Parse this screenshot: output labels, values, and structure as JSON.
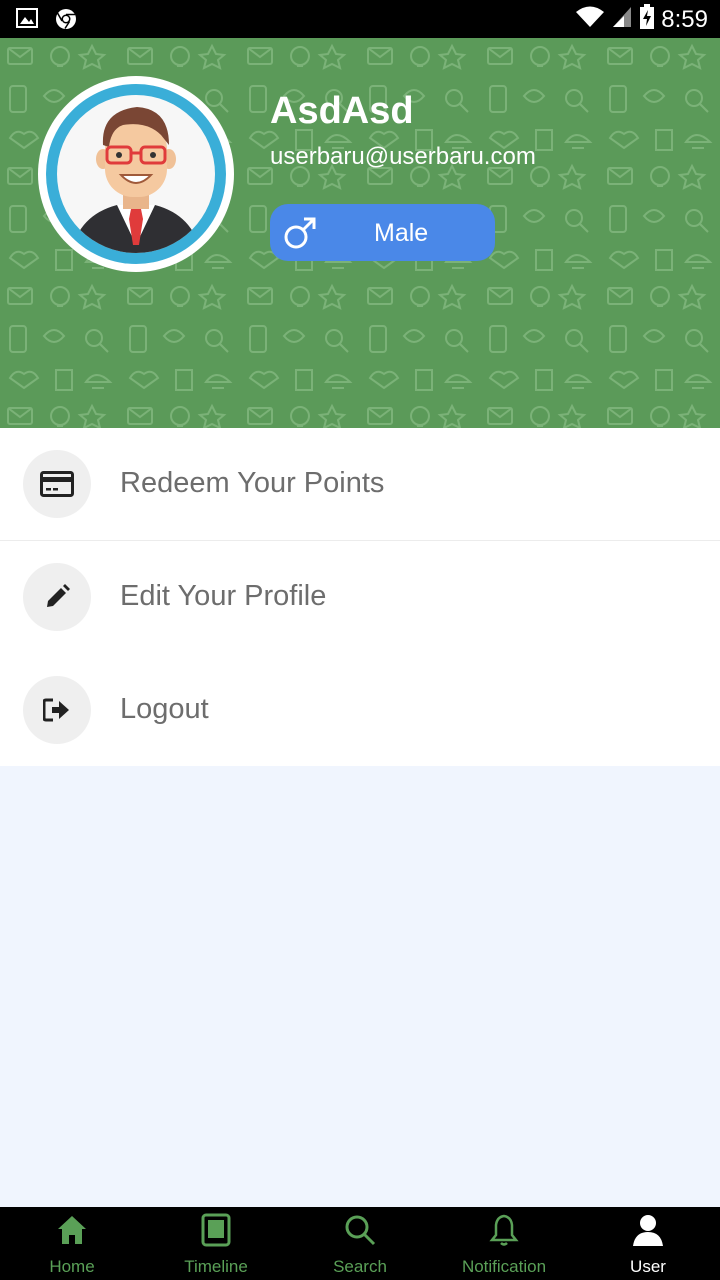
{
  "status_bar": {
    "time": "8:59"
  },
  "profile": {
    "name": "AsdAsd",
    "email": "userbaru@userbaru.com",
    "gender": "Male"
  },
  "menu": {
    "items": [
      {
        "label": "Redeem Your Points",
        "icon": "credit-card-icon"
      },
      {
        "label": "Edit Your Profile",
        "icon": "pencil-icon"
      },
      {
        "label": "Logout",
        "icon": "logout-icon"
      }
    ]
  },
  "bottom_nav": {
    "items": [
      {
        "label": "Home",
        "icon": "home-icon"
      },
      {
        "label": "Timeline",
        "icon": "tablet-icon"
      },
      {
        "label": "Search",
        "icon": "search-icon"
      },
      {
        "label": "Notification",
        "icon": "bell-icon"
      },
      {
        "label": "User",
        "icon": "user-icon"
      }
    ],
    "active": "User"
  },
  "colors": {
    "header_green": "#5b9a59",
    "gender_blue": "#4a88e8",
    "avatar_ring": "#3aaed8",
    "nav_green": "#5aa057",
    "content_bg": "#f0f5fe"
  }
}
